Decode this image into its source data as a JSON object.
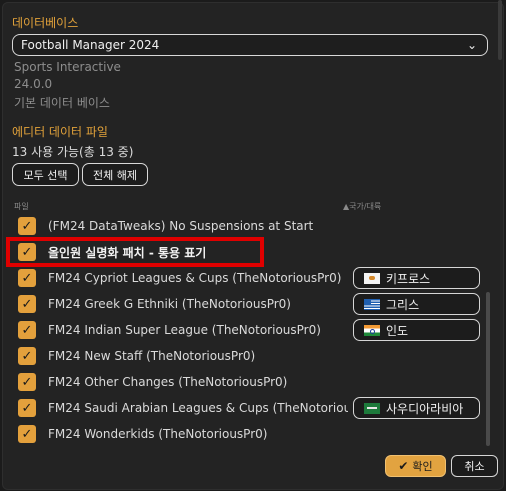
{
  "database": {
    "section_title": "데이터베이스",
    "selected": "Football Manager 2024",
    "publisher": "Sports Interactive",
    "version": "24.0.0",
    "description": "기본 데이터 베이스"
  },
  "editor_files": {
    "section_title": "에디터 데이터 파일",
    "count_text": "13 사용 가능(총 13 중)",
    "select_all": "모두 선택",
    "deselect_all": "전체 해제",
    "col_file": "파일",
    "col_country": "▲국가/대륙",
    "rows": [
      {
        "label": "(FM24 DataTweaks) No Suspensions at Start",
        "checked": true
      },
      {
        "label": "올인원 실명화 패치 - 통용 표기",
        "checked": true
      },
      {
        "label": "FM24 Cypriot Leagues & Cups (TheNotoriousPr0)",
        "checked": true,
        "country": "키프로스",
        "flag": "cyprus-flag-icon"
      },
      {
        "label": "FM24 Greek G Ethniki (TheNotoriousPr0)",
        "checked": true,
        "country": "그리스",
        "flag": "greece-flag-icon"
      },
      {
        "label": "FM24 Indian Super League (TheNotoriousPr0)",
        "checked": true,
        "country": "인도",
        "flag": "india-flag-icon"
      },
      {
        "label": "FM24 New Staff (TheNotoriousPr0)",
        "checked": true
      },
      {
        "label": "FM24 Other Changes (TheNotoriousPr0)",
        "checked": true
      },
      {
        "label": "FM24 Saudi Arabian Leagues & Cups (TheNotorious…",
        "checked": true,
        "country": "사우디아라비아",
        "flag": "saudi-arabia-flag-icon"
      },
      {
        "label": "FM24 Wonderkids (TheNotoriousPr0)",
        "checked": true
      }
    ]
  },
  "footer": {
    "ok": "확인",
    "cancel": "취소"
  },
  "colors": {
    "accent": "#e2a23a",
    "highlight": "#e00000"
  }
}
